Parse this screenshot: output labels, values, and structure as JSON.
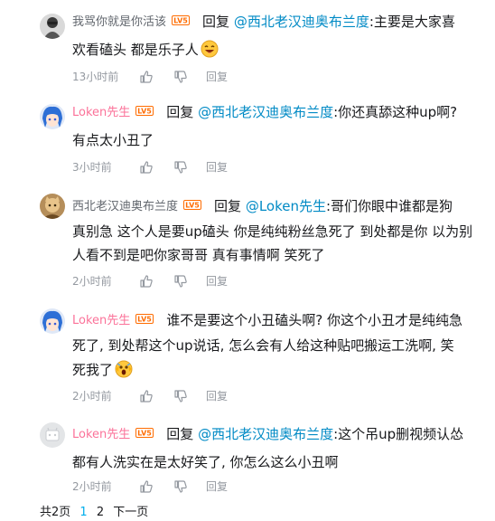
{
  "replies": [
    {
      "username": "我骂你就是你活该",
      "level": "LV5",
      "reply_word": "回复",
      "mention": "@西北老汉迪奥布兰度",
      "lines": [
        ":主要是大家喜",
        "欢看磕头 都是乐子人"
      ],
      "emoji": "laughing-emoji",
      "time": "13小时前",
      "reply_label": "回复"
    },
    {
      "username": "Loken先生",
      "level": "LV5",
      "reply_word": "回复",
      "mention": "@西北老汉迪奥布兰度",
      "lines": [
        ":你还真舔这种up啊?",
        "有点太小丑了"
      ],
      "time": "3小时前",
      "reply_label": "回复"
    },
    {
      "username": "西北老汉迪奥布兰度",
      "level": "LV5",
      "reply_word": "回复",
      "mention": "@Loken先生",
      "lines": [
        ":哥们你眼中谁都是狗",
        "真别急 这个人是要up磕头 你是纯纯粉丝急死了 到处都是你 以为别",
        "人看不到是吧你家哥哥 真有事情啊 笑死了"
      ],
      "time": "2小时前",
      "reply_label": "回复"
    },
    {
      "username": "Loken先生",
      "level": "LV5",
      "lines": [
        "谁不是要这个小丑磕头啊? 你这个小丑才是纯纯急",
        "死了, 到处帮这个up说话, 怎么会有人给这种贴吧搬运工洗啊, 笑",
        "死我了"
      ],
      "emoji": "scream-emoji",
      "time": "2小时前",
      "reply_label": "回复"
    },
    {
      "username": "Loken先生",
      "level": "LV5",
      "reply_word": "回复",
      "mention": "@西北老汉迪奥布兰度",
      "lines": [
        ":这个吊up删视频认怂",
        "都有人洗实在是太好笑了, 你怎么这么小丑啊"
      ],
      "time": "2小时前",
      "reply_label": "回复"
    }
  ],
  "pagination": {
    "total": "共2页",
    "page1": "1",
    "page2": "2",
    "next": "下一页"
  },
  "colors": {
    "vip_name": "#fb7299",
    "mention": "#008ac5",
    "meta": "#9499a0",
    "level_badge": "#ff6c00",
    "current_page": "#00aeec"
  }
}
